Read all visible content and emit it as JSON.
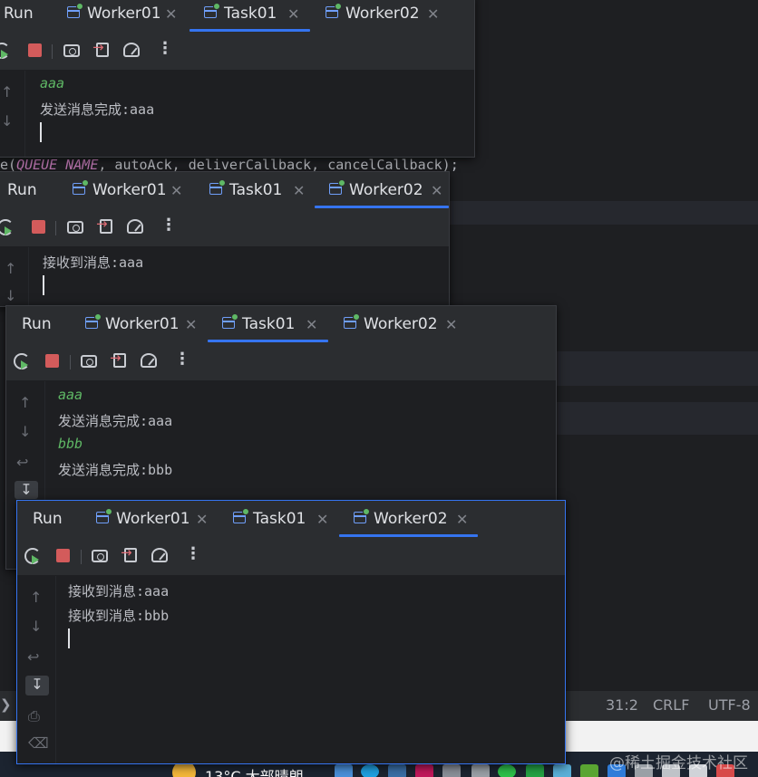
{
  "editor": {
    "code_prefix": "e(",
    "code_constant": "QUEUE_NAME",
    "code_rest": ", autoAck, deliverCallback, cancelCallback);"
  },
  "status_bar": {
    "position": "31:2",
    "line_endings": "CRLF",
    "encoding": "UTF-8"
  },
  "taskbar": {
    "weather": "13°C  大部晴朗"
  },
  "watermark": "@稀土掘金技术社区",
  "windows": [
    {
      "run_label": "Run",
      "tabs": [
        {
          "label": "Worker01"
        },
        {
          "label": "Task01"
        },
        {
          "label": "Worker02"
        }
      ],
      "active_tab": "Task01",
      "console": [
        {
          "text": "aaa",
          "type": "input"
        },
        {
          "text": "发送消息完成:aaa",
          "type": "output"
        }
      ]
    },
    {
      "run_label": "Run",
      "tabs": [
        {
          "label": "Worker01"
        },
        {
          "label": "Task01"
        },
        {
          "label": "Worker02"
        }
      ],
      "active_tab": "Worker02",
      "console": [
        {
          "text": "接收到消息:aaa",
          "type": "output"
        }
      ]
    },
    {
      "run_label": "Run",
      "tabs": [
        {
          "label": "Worker01"
        },
        {
          "label": "Task01"
        },
        {
          "label": "Worker02"
        }
      ],
      "active_tab": "Task01",
      "console": [
        {
          "text": "aaa",
          "type": "input"
        },
        {
          "text": "发送消息完成:aaa",
          "type": "output"
        },
        {
          "text": "bbb",
          "type": "input"
        },
        {
          "text": "发送消息完成:bbb",
          "type": "output"
        }
      ]
    },
    {
      "run_label": "Run",
      "tabs": [
        {
          "label": "Worker01"
        },
        {
          "label": "Task01"
        },
        {
          "label": "Worker02"
        }
      ],
      "active_tab": "Worker02",
      "console": [
        {
          "text": "接收到消息:aaa",
          "type": "output"
        },
        {
          "text": "接收到消息:bbb",
          "type": "output"
        }
      ]
    }
  ],
  "icons": {
    "toolbar": [
      "rerun-icon",
      "stop-icon",
      "screenshot-icon",
      "exit-icon",
      "profiler-icon",
      "more-icon"
    ],
    "gutter": [
      "arrow-up-icon",
      "arrow-down-icon",
      "soft-wrap-icon",
      "scroll-to-end-icon",
      "print-icon",
      "trash-icon"
    ]
  },
  "colors": {
    "accent": "#3574f0",
    "panel": "#2b2d30",
    "console_bg": "#1e1f22",
    "input_text": "#5fb865",
    "stop": "#d35b5b"
  }
}
